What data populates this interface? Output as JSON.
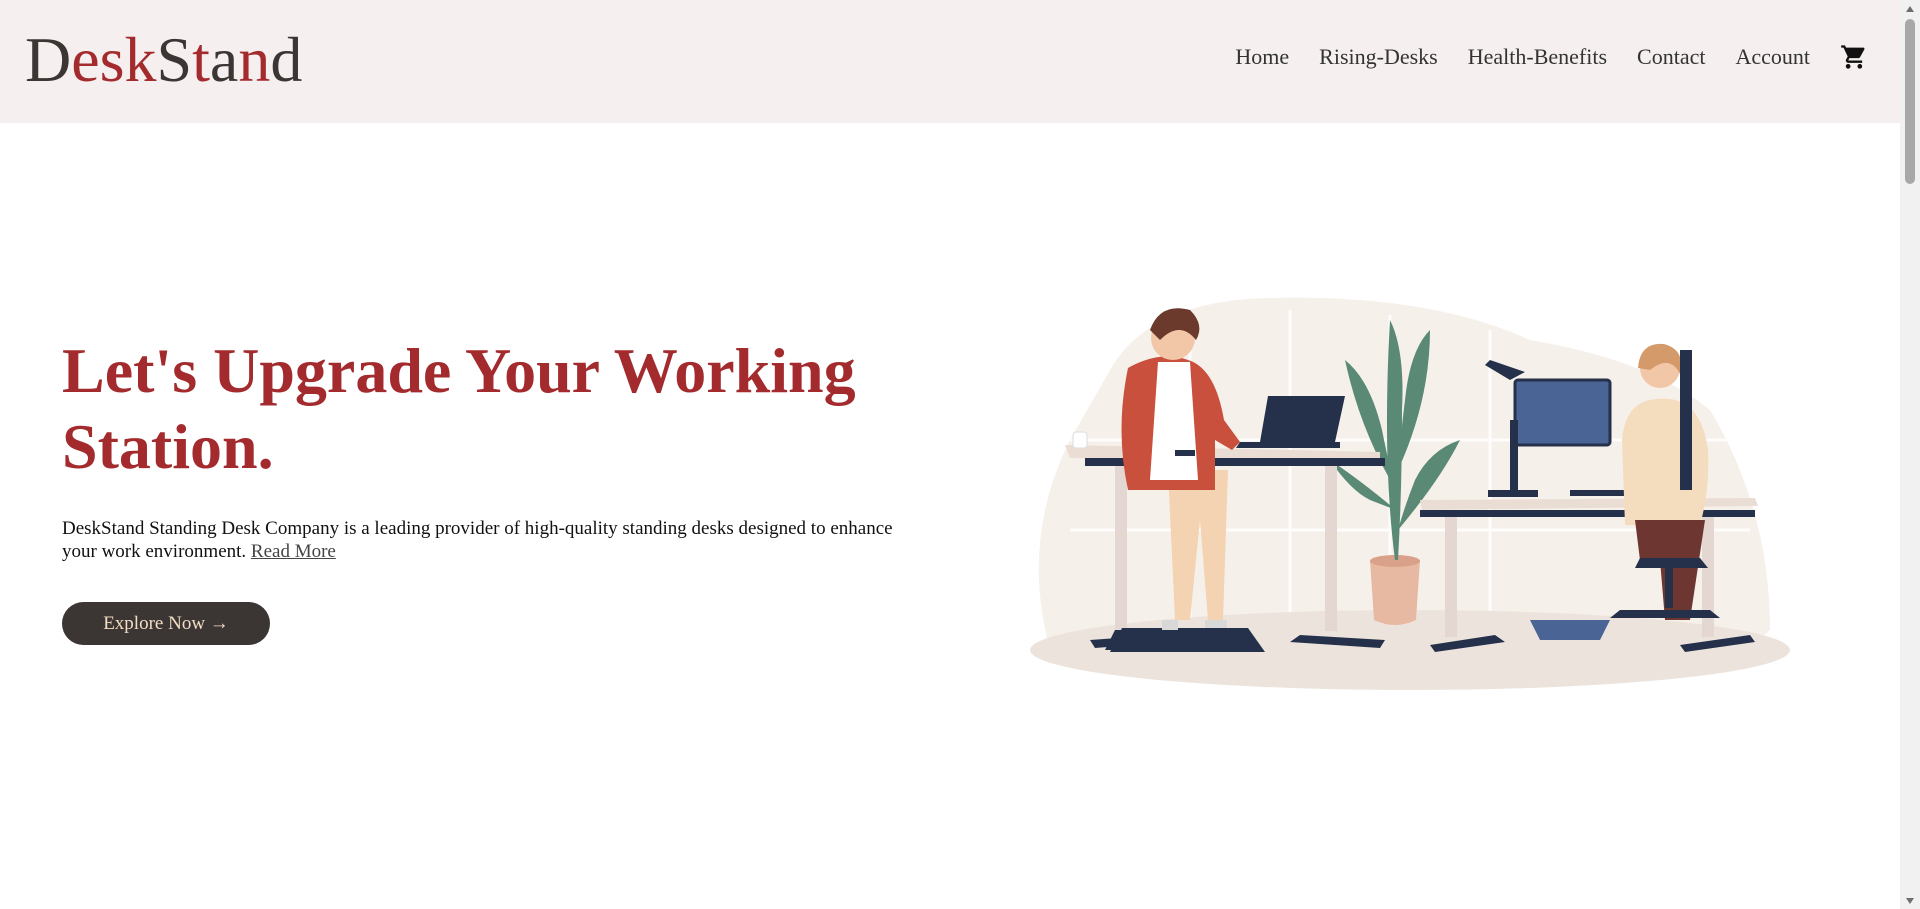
{
  "header": {
    "logo": {
      "letters": [
        {
          "ch": "D",
          "color": "#3b3533"
        },
        {
          "ch": "e",
          "color": "#a32b2e"
        },
        {
          "ch": "s",
          "color": "#a32b2e"
        },
        {
          "ch": "k",
          "color": "#a32b2e"
        },
        {
          "ch": "S",
          "color": "#3b3533"
        },
        {
          "ch": "t",
          "color": "#a32b2e"
        },
        {
          "ch": "a",
          "color": "#3b3533"
        },
        {
          "ch": "n",
          "color": "#a32b2e"
        },
        {
          "ch": "d",
          "color": "#3b3533"
        }
      ]
    },
    "nav": {
      "home": "Home",
      "rising_desks": "Rising-Desks",
      "health_benefits": "Health-Benefits",
      "contact": "Contact",
      "account": "Account",
      "cart_icon": "cart-icon"
    },
    "background": "#f5efef"
  },
  "hero": {
    "title_line1": "Let's Upgrade Your Working",
    "title_line2": "Station.",
    "description_line1": "DeskStand Standing Desk Company is a leading provider of high-quality standing desks designed to enhance",
    "description_line2": "your work environment.",
    "read_more": "Read More",
    "explore_button": "Explore Now →",
    "title_color": "#a32b2e",
    "button_color": "#3b3533",
    "button_text_color": "#f3ddc4"
  },
  "icons": {
    "scroll_up": "scroll-up-arrow-icon",
    "scroll_down": "scroll-down-arrow-icon"
  }
}
